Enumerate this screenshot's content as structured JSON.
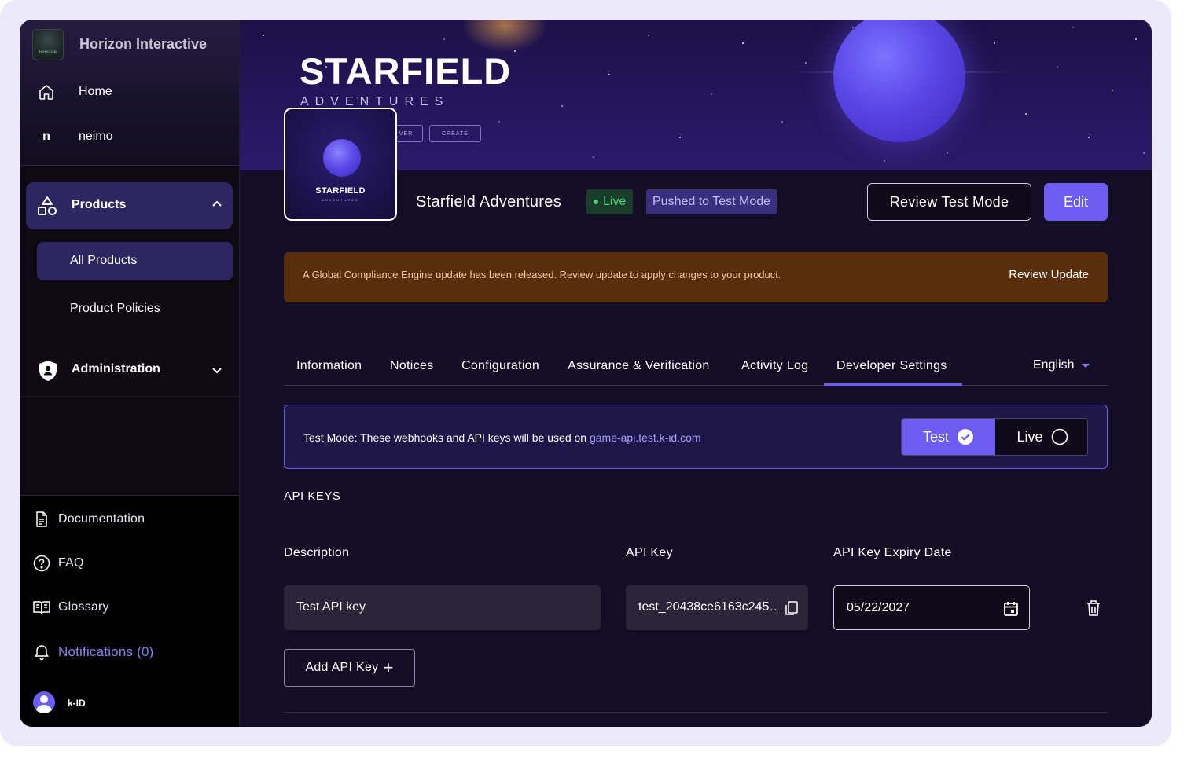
{
  "sidebar": {
    "org_name": "Horizon Interactive",
    "org_logo_text": "HORIZON",
    "nav": [
      {
        "label": "Home",
        "icon": "home-icon"
      },
      {
        "label": "neimo",
        "icon": "n"
      }
    ],
    "products": {
      "label": "Products",
      "icon": "shapes-icon",
      "expanded": true,
      "items": [
        {
          "label": "All Products",
          "active": true
        },
        {
          "label": "Product Policies",
          "active": false
        }
      ]
    },
    "administration": {
      "label": "Administration",
      "icon": "shield-icon",
      "expanded": false
    },
    "footer": [
      {
        "label": "Documentation",
        "icon": "document-icon"
      },
      {
        "label": "FAQ",
        "icon": "question-icon"
      },
      {
        "label": "Glossary",
        "icon": "book-icon"
      },
      {
        "label": "Notifications (0)",
        "icon": "bell-icon"
      }
    ],
    "user": {
      "name": "k-ID"
    }
  },
  "banner": {
    "title": "STARFIELD",
    "subtitle": "ADVENTURES",
    "buttons": [
      "VER",
      "CREATE"
    ]
  },
  "product": {
    "thumb_title": "STARFIELD",
    "thumb_subtitle": "ADVENTURES",
    "name": "Starfield Adventures",
    "status_live": "Live",
    "status_test": "Pushed to Test Mode",
    "review_button": "Review Test Mode",
    "edit_button": "Edit"
  },
  "alert": {
    "message": "A Global Compliance Engine update has been released. Review update to apply changes to your product.",
    "action": "Review Update",
    "color": "#5a2e0b"
  },
  "tabs": [
    {
      "label": "Information"
    },
    {
      "label": "Notices"
    },
    {
      "label": "Configuration"
    },
    {
      "label": "Assurance & Verification"
    },
    {
      "label": "Activity Log"
    },
    {
      "label": "Developer Settings",
      "active": true
    }
  ],
  "language": "English",
  "mode": {
    "message": "Test Mode: These webhooks and API keys will be used on ",
    "link": "game-api.test.k-id.com",
    "test_label": "Test",
    "live_label": "Live",
    "selected": "Test"
  },
  "api_keys": {
    "section_title": "API KEYS",
    "columns": [
      "Description",
      "API Key",
      "API Key Expiry Date"
    ],
    "rows": [
      {
        "description": "Test API key",
        "key": "test_20438ce6163c245…",
        "expiry": "05/22/2027"
      }
    ],
    "add_button": "Add API Key"
  },
  "colors": {
    "accent": "#6c5cf0",
    "live_green": "#46d37b",
    "bg": "#130d26"
  }
}
